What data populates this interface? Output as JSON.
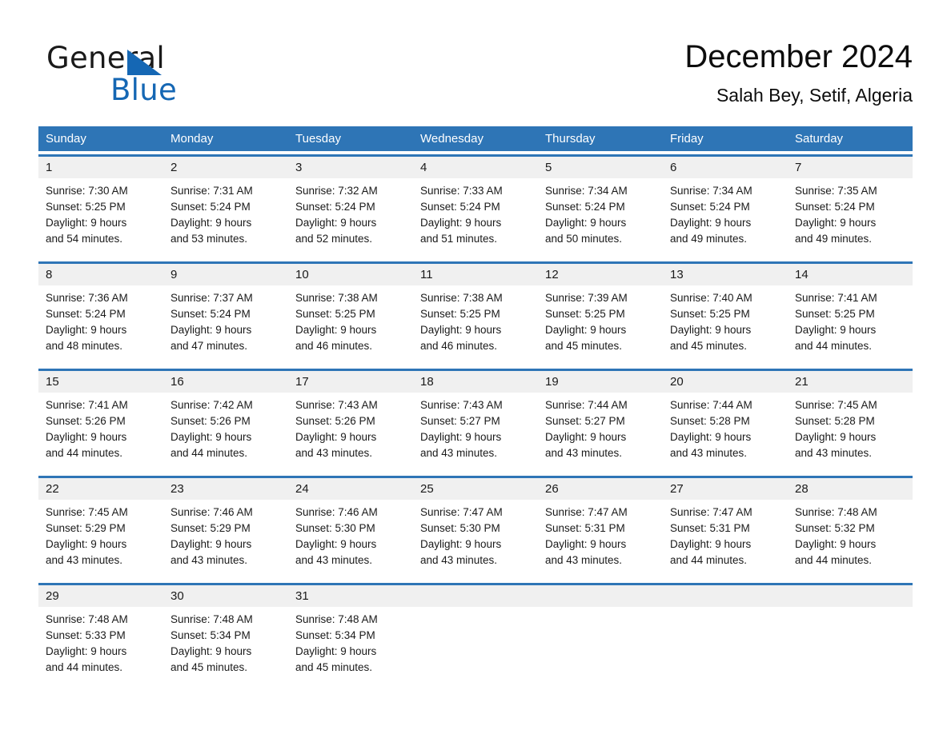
{
  "brand": {
    "name_part1": "General",
    "name_part2": "Blue",
    "logo_icon": "triangle-flag-icon",
    "accent_color": "#1567b4"
  },
  "header": {
    "month_title": "December 2024",
    "location": "Salah Bey, Setif, Algeria"
  },
  "calendar": {
    "header_bg": "#2e75b6",
    "date_band_bg": "#f0f0f0",
    "weekday_headers": [
      "Sunday",
      "Monday",
      "Tuesday",
      "Wednesday",
      "Thursday",
      "Friday",
      "Saturday"
    ],
    "weeks": [
      [
        {
          "date": "1",
          "lines": [
            "Sunrise: 7:30 AM",
            "Sunset: 5:25 PM",
            "Daylight: 9 hours",
            "and 54 minutes."
          ]
        },
        {
          "date": "2",
          "lines": [
            "Sunrise: 7:31 AM",
            "Sunset: 5:24 PM",
            "Daylight: 9 hours",
            "and 53 minutes."
          ]
        },
        {
          "date": "3",
          "lines": [
            "Sunrise: 7:32 AM",
            "Sunset: 5:24 PM",
            "Daylight: 9 hours",
            "and 52 minutes."
          ]
        },
        {
          "date": "4",
          "lines": [
            "Sunrise: 7:33 AM",
            "Sunset: 5:24 PM",
            "Daylight: 9 hours",
            "and 51 minutes."
          ]
        },
        {
          "date": "5",
          "lines": [
            "Sunrise: 7:34 AM",
            "Sunset: 5:24 PM",
            "Daylight: 9 hours",
            "and 50 minutes."
          ]
        },
        {
          "date": "6",
          "lines": [
            "Sunrise: 7:34 AM",
            "Sunset: 5:24 PM",
            "Daylight: 9 hours",
            "and 49 minutes."
          ]
        },
        {
          "date": "7",
          "lines": [
            "Sunrise: 7:35 AM",
            "Sunset: 5:24 PM",
            "Daylight: 9 hours",
            "and 49 minutes."
          ]
        }
      ],
      [
        {
          "date": "8",
          "lines": [
            "Sunrise: 7:36 AM",
            "Sunset: 5:24 PM",
            "Daylight: 9 hours",
            "and 48 minutes."
          ]
        },
        {
          "date": "9",
          "lines": [
            "Sunrise: 7:37 AM",
            "Sunset: 5:24 PM",
            "Daylight: 9 hours",
            "and 47 minutes."
          ]
        },
        {
          "date": "10",
          "lines": [
            "Sunrise: 7:38 AM",
            "Sunset: 5:25 PM",
            "Daylight: 9 hours",
            "and 46 minutes."
          ]
        },
        {
          "date": "11",
          "lines": [
            "Sunrise: 7:38 AM",
            "Sunset: 5:25 PM",
            "Daylight: 9 hours",
            "and 46 minutes."
          ]
        },
        {
          "date": "12",
          "lines": [
            "Sunrise: 7:39 AM",
            "Sunset: 5:25 PM",
            "Daylight: 9 hours",
            "and 45 minutes."
          ]
        },
        {
          "date": "13",
          "lines": [
            "Sunrise: 7:40 AM",
            "Sunset: 5:25 PM",
            "Daylight: 9 hours",
            "and 45 minutes."
          ]
        },
        {
          "date": "14",
          "lines": [
            "Sunrise: 7:41 AM",
            "Sunset: 5:25 PM",
            "Daylight: 9 hours",
            "and 44 minutes."
          ]
        }
      ],
      [
        {
          "date": "15",
          "lines": [
            "Sunrise: 7:41 AM",
            "Sunset: 5:26 PM",
            "Daylight: 9 hours",
            "and 44 minutes."
          ]
        },
        {
          "date": "16",
          "lines": [
            "Sunrise: 7:42 AM",
            "Sunset: 5:26 PM",
            "Daylight: 9 hours",
            "and 44 minutes."
          ]
        },
        {
          "date": "17",
          "lines": [
            "Sunrise: 7:43 AM",
            "Sunset: 5:26 PM",
            "Daylight: 9 hours",
            "and 43 minutes."
          ]
        },
        {
          "date": "18",
          "lines": [
            "Sunrise: 7:43 AM",
            "Sunset: 5:27 PM",
            "Daylight: 9 hours",
            "and 43 minutes."
          ]
        },
        {
          "date": "19",
          "lines": [
            "Sunrise: 7:44 AM",
            "Sunset: 5:27 PM",
            "Daylight: 9 hours",
            "and 43 minutes."
          ]
        },
        {
          "date": "20",
          "lines": [
            "Sunrise: 7:44 AM",
            "Sunset: 5:28 PM",
            "Daylight: 9 hours",
            "and 43 minutes."
          ]
        },
        {
          "date": "21",
          "lines": [
            "Sunrise: 7:45 AM",
            "Sunset: 5:28 PM",
            "Daylight: 9 hours",
            "and 43 minutes."
          ]
        }
      ],
      [
        {
          "date": "22",
          "lines": [
            "Sunrise: 7:45 AM",
            "Sunset: 5:29 PM",
            "Daylight: 9 hours",
            "and 43 minutes."
          ]
        },
        {
          "date": "23",
          "lines": [
            "Sunrise: 7:46 AM",
            "Sunset: 5:29 PM",
            "Daylight: 9 hours",
            "and 43 minutes."
          ]
        },
        {
          "date": "24",
          "lines": [
            "Sunrise: 7:46 AM",
            "Sunset: 5:30 PM",
            "Daylight: 9 hours",
            "and 43 minutes."
          ]
        },
        {
          "date": "25",
          "lines": [
            "Sunrise: 7:47 AM",
            "Sunset: 5:30 PM",
            "Daylight: 9 hours",
            "and 43 minutes."
          ]
        },
        {
          "date": "26",
          "lines": [
            "Sunrise: 7:47 AM",
            "Sunset: 5:31 PM",
            "Daylight: 9 hours",
            "and 43 minutes."
          ]
        },
        {
          "date": "27",
          "lines": [
            "Sunrise: 7:47 AM",
            "Sunset: 5:31 PM",
            "Daylight: 9 hours",
            "and 44 minutes."
          ]
        },
        {
          "date": "28",
          "lines": [
            "Sunrise: 7:48 AM",
            "Sunset: 5:32 PM",
            "Daylight: 9 hours",
            "and 44 minutes."
          ]
        }
      ],
      [
        {
          "date": "29",
          "lines": [
            "Sunrise: 7:48 AM",
            "Sunset: 5:33 PM",
            "Daylight: 9 hours",
            "and 44 minutes."
          ]
        },
        {
          "date": "30",
          "lines": [
            "Sunrise: 7:48 AM",
            "Sunset: 5:34 PM",
            "Daylight: 9 hours",
            "and 45 minutes."
          ]
        },
        {
          "date": "31",
          "lines": [
            "Sunrise: 7:48 AM",
            "Sunset: 5:34 PM",
            "Daylight: 9 hours",
            "and 45 minutes."
          ]
        },
        {
          "date": "",
          "lines": []
        },
        {
          "date": "",
          "lines": []
        },
        {
          "date": "",
          "lines": []
        },
        {
          "date": "",
          "lines": []
        }
      ]
    ]
  }
}
